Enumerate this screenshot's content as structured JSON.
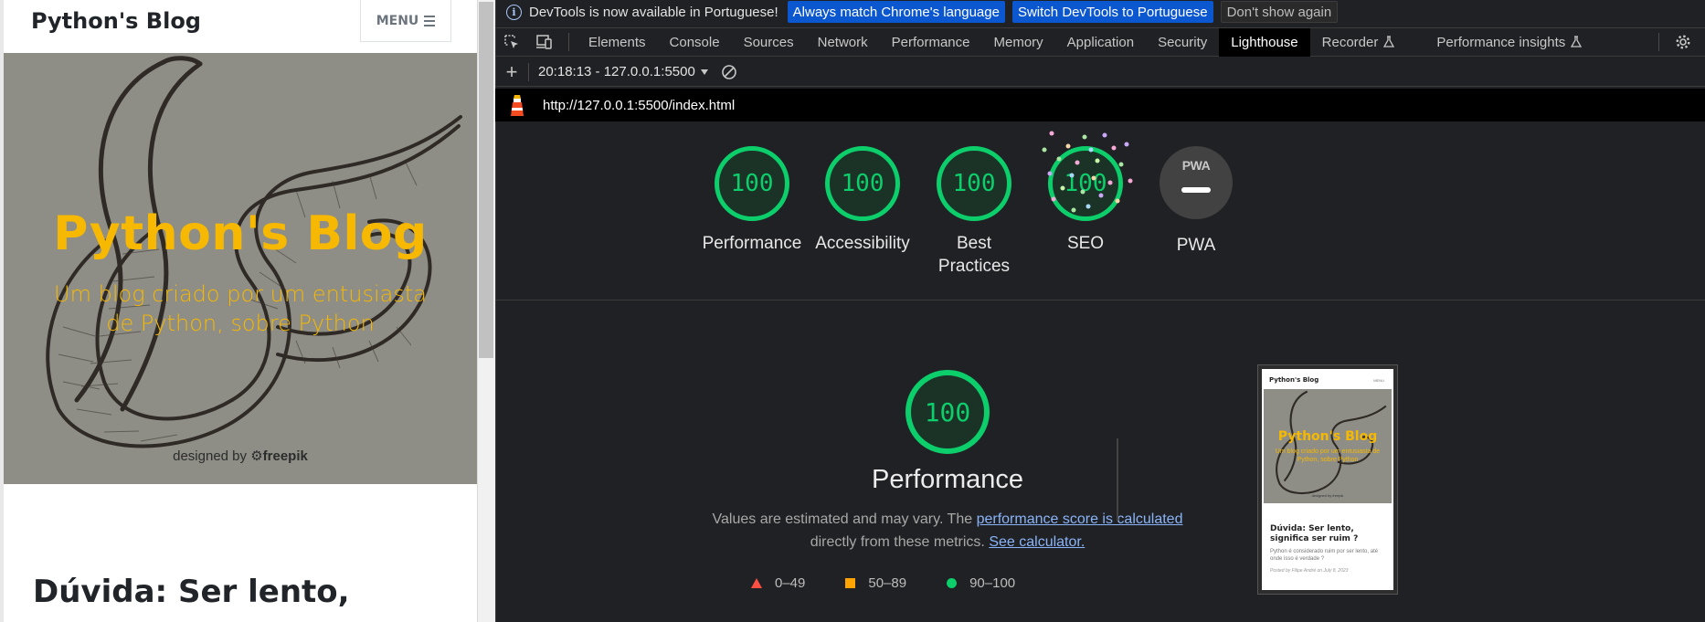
{
  "preview": {
    "brand": "Python's Blog",
    "menu_label": "MENU",
    "hero_title": "Python's Blog",
    "hero_subtitle": "Um blog criado por um entusiasta de Python, sobre Python",
    "credit_prefix": "designed by",
    "credit_brand": "freepik",
    "post_title": "Dúvida: Ser lento,"
  },
  "infobar": {
    "message": "DevTools is now available in Portuguese!",
    "btn_match": "Always match Chrome's language",
    "btn_switch": "Switch DevTools to Portuguese",
    "btn_dismiss": "Don't show again"
  },
  "tabs": [
    {
      "label": "Elements"
    },
    {
      "label": "Console"
    },
    {
      "label": "Sources"
    },
    {
      "label": "Network"
    },
    {
      "label": "Performance"
    },
    {
      "label": "Memory"
    },
    {
      "label": "Application"
    },
    {
      "label": "Security"
    },
    {
      "label": "Lighthouse",
      "active": true
    },
    {
      "label": "Recorder"
    },
    {
      "label": "Performance insights"
    }
  ],
  "toolbar": {
    "run_label": "20:18:13 - 127.0.0.1:5500"
  },
  "report": {
    "url": "http://127.0.0.1:5500/index.html",
    "gauges": [
      {
        "score": "100",
        "label": "Performance"
      },
      {
        "score": "100",
        "label": "Accessibility"
      },
      {
        "score": "100",
        "label": "Best Practices"
      },
      {
        "score": "100",
        "label": "SEO"
      }
    ],
    "pwa": {
      "badge": "PWA",
      "label": "PWA"
    },
    "performance": {
      "score": "100",
      "title": "Performance",
      "desc_prefix": "Values are estimated and may vary. The",
      "desc_link1": "performance score is calculated",
      "desc_mid": "directly from these metrics.",
      "desc_link2": "See calculator."
    },
    "legend": {
      "fail": "0–49",
      "average": "50–89",
      "pass": "90–100"
    },
    "thumbnail": {
      "brand": "Python's Blog",
      "menu": "MENU",
      "hero_title": "Python's Blog",
      "hero_subtitle": "Um blog criado por um entusiasta de Python, sobre Python",
      "credit": "designed by freepik",
      "post_title": "Dúvida: Ser lento, significa ser ruim ?",
      "excerpt": "Python é considerado ruim por ser lento, até onde isso é verdade ?",
      "meta": "Posted by Filipe André on July 8, 2023"
    }
  },
  "colors": {
    "pass": "#0cce6b",
    "average": "#ffa400",
    "fail": "#ff4e42",
    "hero_bg": "#8e8e87",
    "hero_text": "#f6b800",
    "devtools_bg": "#202124",
    "button_blue": "#0b57d0"
  }
}
